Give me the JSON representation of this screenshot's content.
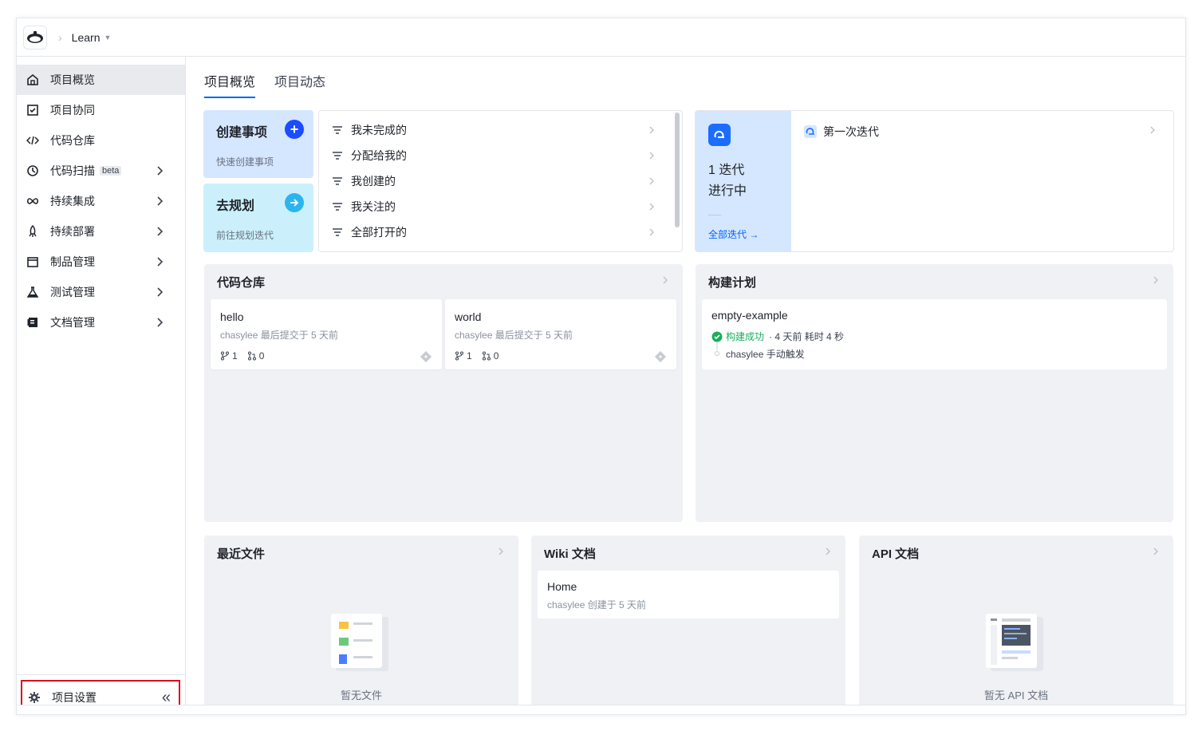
{
  "topbar": {
    "project_name": "Learn"
  },
  "sidebar": {
    "items": [
      {
        "label": "项目概览",
        "icon": "home-icon",
        "active": true,
        "expandable": false
      },
      {
        "label": "项目协同",
        "icon": "checkbox-icon",
        "active": false,
        "expandable": false
      },
      {
        "label": "代码仓库",
        "icon": "code-icon",
        "active": false,
        "expandable": false
      },
      {
        "label": "代码扫描",
        "icon": "scan-icon",
        "active": false,
        "expandable": true,
        "badge": "beta"
      },
      {
        "label": "持续集成",
        "icon": "infinity-icon",
        "active": false,
        "expandable": true
      },
      {
        "label": "持续部署",
        "icon": "rocket-icon",
        "active": false,
        "expandable": true
      },
      {
        "label": "制品管理",
        "icon": "package-icon",
        "active": false,
        "expandable": true
      },
      {
        "label": "测试管理",
        "icon": "flask-icon",
        "active": false,
        "expandable": true
      },
      {
        "label": "文档管理",
        "icon": "document-icon",
        "active": false,
        "expandable": true
      }
    ],
    "settings_label": "项目设置"
  },
  "tabs": [
    {
      "label": "项目概览",
      "active": true
    },
    {
      "label": "项目动态",
      "active": false
    }
  ],
  "quick": {
    "create_title": "创建事项",
    "create_sub": "快速创建事项",
    "plan_title": "去规划",
    "plan_sub": "前往规划迭代"
  },
  "filters": [
    "我未完成的",
    "分配给我的",
    "我创建的",
    "我关注的",
    "全部打开的"
  ],
  "iteration": {
    "count_line1": "1 迭代",
    "count_line2": "进行中",
    "all_link": "全部迭代 →",
    "item": "第一次迭代"
  },
  "repos_card": {
    "title": "代码仓库",
    "repos": [
      {
        "name": "hello",
        "meta": "chasylee 最后提交于 5 天前",
        "branches": "1",
        "mrs": "0"
      },
      {
        "name": "world",
        "meta": "chasylee 最后提交于 5 天前",
        "branches": "1",
        "mrs": "0"
      }
    ]
  },
  "build_card": {
    "title": "构建计划",
    "name": "empty-example",
    "status": "构建成功",
    "time": "· 4 天前   耗时 4 秒",
    "trigger": "chasylee 手动触发"
  },
  "files_card": {
    "title": "最近文件",
    "empty": "暂无文件"
  },
  "wiki_card": {
    "title": "Wiki 文档",
    "item_name": "Home",
    "item_meta": "chasylee 创建于 5 天前"
  },
  "api_card": {
    "title": "API 文档",
    "empty": "暂无 API 文档"
  },
  "colors": {
    "primary": "#0066ff",
    "success": "#1aae5b",
    "highlight_border": "#d80f1c"
  }
}
